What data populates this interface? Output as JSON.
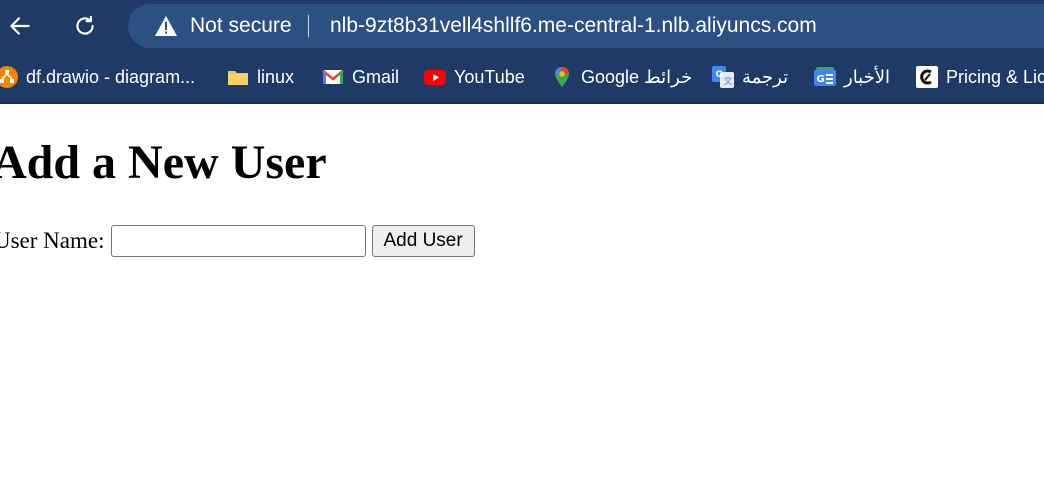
{
  "browser": {
    "security_status": "Not secure",
    "url": "nlb-9zt8b31vell4shllf6.me-central-1.nlb.aliyuncs.com",
    "icons": {
      "back": "back-arrow-icon",
      "reload": "reload-icon",
      "security": "warning-triangle-icon"
    }
  },
  "bookmarks": [
    {
      "label": "df.drawio - diagram...",
      "icon": "drawio-icon"
    },
    {
      "label": "linux",
      "icon": "folder-icon"
    },
    {
      "label": "Gmail",
      "icon": "gmail-icon"
    },
    {
      "label": "YouTube",
      "icon": "youtube-icon"
    },
    {
      "label": "Google خرائط",
      "icon": "google-maps-icon"
    },
    {
      "label": "ترجمة",
      "icon": "google-translate-icon"
    },
    {
      "label": "الأخبار",
      "icon": "google-news-icon"
    },
    {
      "label": "Pricing & Lic",
      "icon": "pricing-site-icon"
    }
  ],
  "page": {
    "title": "Add a New User",
    "form": {
      "label": "User Name:",
      "input_value": "",
      "button_label": "Add User"
    }
  },
  "colors": {
    "chrome_bg": "#1f3a66",
    "omnibox_bg": "#2d5083"
  }
}
